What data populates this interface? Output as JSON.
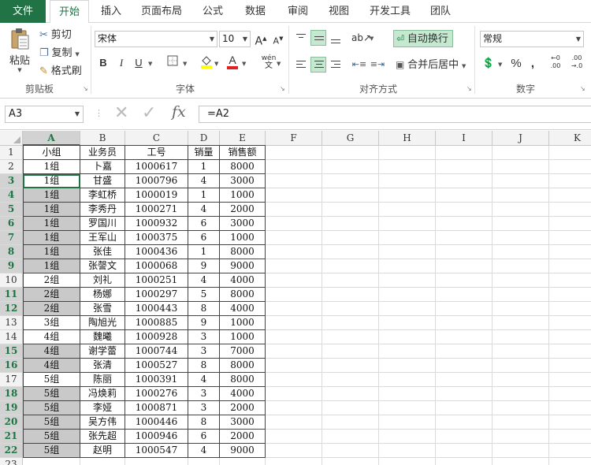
{
  "tabs": [
    "文件",
    "开始",
    "插入",
    "页面布局",
    "公式",
    "数据",
    "审阅",
    "视图",
    "开发工具",
    "团队"
  ],
  "active_tab": "开始",
  "ribbon": {
    "clipboard": {
      "label": "剪贴板",
      "paste": "粘贴",
      "cut": "剪切",
      "copy": "复制",
      "format_painter": "格式刷"
    },
    "font": {
      "label": "字体",
      "name": "宋体",
      "size": "10",
      "bold": "B",
      "italic": "I",
      "underline": "U",
      "grow": "A",
      "shrink": "A",
      "phonetic": "wén"
    },
    "alignment": {
      "label": "对齐方式",
      "wrap": "自动换行",
      "merge": "合并后居中"
    },
    "number": {
      "label": "数字",
      "format": "常规",
      "percent": "%",
      "comma": ",",
      "inc_decimal": "←0 .00",
      "dec_decimal": ".00 →.0"
    }
  },
  "formula_bar": {
    "name_box": "A3",
    "formula": "=A2",
    "fx": "fx"
  },
  "colors": {
    "accent": "#217346",
    "shade": "#c9c9c9"
  },
  "columns": [
    "A",
    "B",
    "C",
    "D",
    "E",
    "F",
    "G",
    "H",
    "I",
    "J",
    "K"
  ],
  "selected_column": "A",
  "selected_rows": [
    3,
    4,
    5,
    6,
    7,
    8,
    9,
    11,
    12,
    15,
    16,
    18,
    19,
    20,
    21,
    22
  ],
  "active_cell": "A3",
  "row_numbers": [
    "1",
    "2",
    "3",
    "4",
    "5",
    "6",
    "7",
    "8",
    "9",
    "10",
    "11",
    "12",
    "13",
    "14",
    "15",
    "16",
    "17",
    "18",
    "19",
    "20",
    "21",
    "22",
    "23"
  ],
  "table": {
    "headers": [
      "小组",
      "业务员",
      "工号",
      "销量",
      "销售额"
    ],
    "rows": [
      [
        "1组",
        "卜嘉",
        "1000617",
        "1",
        "8000"
      ],
      [
        "1组",
        "甘盛",
        "1000796",
        "4",
        "3000"
      ],
      [
        "1组",
        "李虹桥",
        "1000019",
        "1",
        "1000"
      ],
      [
        "1组",
        "李秀丹",
        "1000271",
        "4",
        "2000"
      ],
      [
        "1组",
        "罗国川",
        "1000932",
        "6",
        "3000"
      ],
      [
        "1组",
        "王军山",
        "1000375",
        "6",
        "1000"
      ],
      [
        "1组",
        "张佳",
        "1000436",
        "1",
        "8000"
      ],
      [
        "1组",
        "张謦文",
        "1000068",
        "9",
        "9000"
      ],
      [
        "2组",
        "刘礼",
        "1000251",
        "4",
        "4000"
      ],
      [
        "2组",
        "杨娜",
        "1000297",
        "5",
        "8000"
      ],
      [
        "2组",
        "张雪",
        "1000443",
        "8",
        "4000"
      ],
      [
        "3组",
        "陶旭光",
        "1000885",
        "9",
        "1000"
      ],
      [
        "4组",
        "魏曦",
        "1000928",
        "3",
        "1000"
      ],
      [
        "4组",
        "谢学蕾",
        "1000744",
        "3",
        "7000"
      ],
      [
        "4组",
        "张清",
        "1000527",
        "8",
        "8000"
      ],
      [
        "5组",
        "陈丽",
        "1000391",
        "4",
        "8000"
      ],
      [
        "5组",
        "冯焕莉",
        "1000276",
        "3",
        "4000"
      ],
      [
        "5组",
        "李娅",
        "1000871",
        "3",
        "2000"
      ],
      [
        "5组",
        "吴方伟",
        "1000446",
        "8",
        "3000"
      ],
      [
        "5组",
        "张先超",
        "1000946",
        "6",
        "2000"
      ],
      [
        "5组",
        "赵明",
        "1000547",
        "4",
        "9000"
      ]
    ]
  }
}
